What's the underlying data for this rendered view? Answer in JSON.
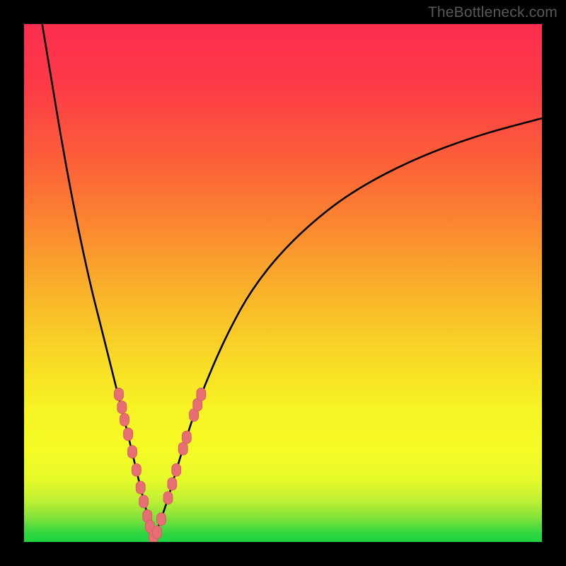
{
  "watermark": "TheBottleneck.com",
  "colors": {
    "black": "#000000",
    "curve": "#000000",
    "marker_fill": "#e76f73",
    "marker_stroke": "#d15a60",
    "green": "#1fd53f"
  },
  "gradient_stops": [
    {
      "offset": 0.0,
      "color": "#fd2e4e"
    },
    {
      "offset": 0.12,
      "color": "#fd3b47"
    },
    {
      "offset": 0.25,
      "color": "#fc5c3a"
    },
    {
      "offset": 0.38,
      "color": "#fb8430"
    },
    {
      "offset": 0.5,
      "color": "#f9ad2a"
    },
    {
      "offset": 0.63,
      "color": "#f8d526"
    },
    {
      "offset": 0.74,
      "color": "#f7f324"
    },
    {
      "offset": 0.82,
      "color": "#f6fb24"
    },
    {
      "offset": 0.88,
      "color": "#e6fa2a"
    },
    {
      "offset": 0.92,
      "color": "#bff033"
    },
    {
      "offset": 0.955,
      "color": "#7ee23a"
    },
    {
      "offset": 0.985,
      "color": "#2bd540"
    },
    {
      "offset": 1.0,
      "color": "#1fd53f"
    }
  ],
  "chart_data": {
    "type": "line",
    "title": "",
    "xlabel": "",
    "ylabel": "",
    "xlim": [
      0,
      100
    ],
    "ylim": [
      0,
      100
    ],
    "series": [
      {
        "name": "left-branch",
        "x": [
          3.5,
          5,
          7,
          9,
          11,
          13,
          15,
          17,
          18.5,
          20,
          21.3,
          22.5,
          23.5,
          24.3,
          25
        ],
        "y": [
          100,
          91,
          79,
          68,
          58,
          49,
          41,
          33,
          27,
          21,
          15.5,
          10.5,
          6.5,
          3,
          0.5
        ]
      },
      {
        "name": "right-branch",
        "x": [
          25,
          26,
          27.5,
          29,
          31,
          33.5,
          36.5,
          40,
          44,
          49,
          55,
          62,
          70,
          79,
          89,
          100
        ],
        "y": [
          0.5,
          3.2,
          7.5,
          12.5,
          19,
          26.5,
          34,
          41.5,
          48.5,
          55,
          61,
          66.5,
          71.2,
          75.3,
          78.8,
          81.8
        ]
      }
    ],
    "markers": [
      {
        "x": 18.3,
        "y": 28.5
      },
      {
        "x": 18.9,
        "y": 26.0
      },
      {
        "x": 19.4,
        "y": 23.6
      },
      {
        "x": 20.1,
        "y": 20.8
      },
      {
        "x": 20.9,
        "y": 17.4
      },
      {
        "x": 21.7,
        "y": 13.9
      },
      {
        "x": 22.5,
        "y": 10.5
      },
      {
        "x": 23.1,
        "y": 7.8
      },
      {
        "x": 23.8,
        "y": 5.0
      },
      {
        "x": 24.3,
        "y": 3.0
      },
      {
        "x": 25.0,
        "y": 1.0
      },
      {
        "x": 25.7,
        "y": 1.9
      },
      {
        "x": 26.5,
        "y": 4.4
      },
      {
        "x": 27.8,
        "y": 8.5
      },
      {
        "x": 28.6,
        "y": 11.2
      },
      {
        "x": 29.4,
        "y": 13.9
      },
      {
        "x": 30.7,
        "y": 18.0
      },
      {
        "x": 31.4,
        "y": 20.2
      },
      {
        "x": 32.8,
        "y": 24.5
      },
      {
        "x": 33.5,
        "y": 26.5
      },
      {
        "x": 34.2,
        "y": 28.5
      }
    ]
  }
}
